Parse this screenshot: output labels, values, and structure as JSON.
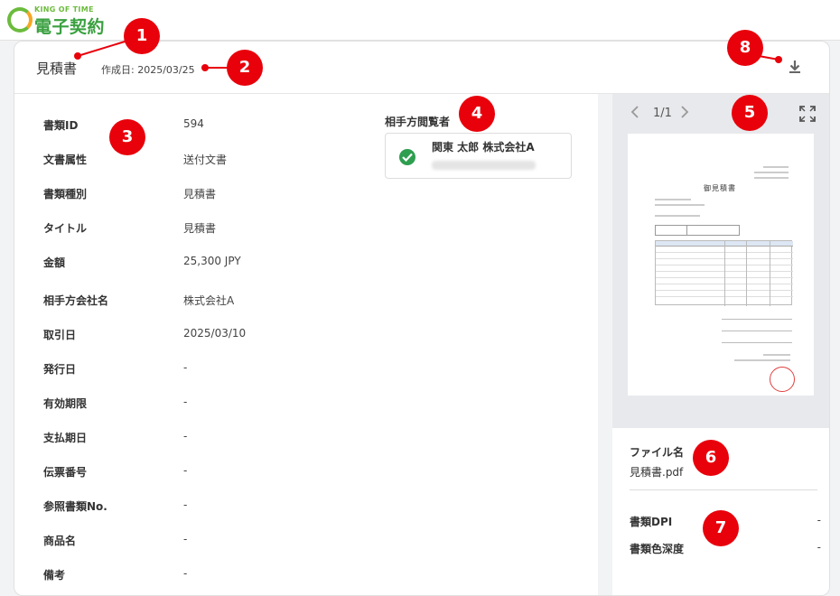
{
  "brand": {
    "top": "KING OF TIME",
    "main": "電子契約"
  },
  "header": {
    "doc_title": "見積書",
    "created": "作成日: 2025/03/25"
  },
  "fields": [
    {
      "label": "書類ID",
      "value": "594"
    },
    {
      "label": "文書属性",
      "value": "送付文書"
    },
    {
      "label": "書類種別",
      "value": "見積書"
    },
    {
      "label": "タイトル",
      "value": "見積書"
    },
    {
      "label": "金額",
      "value": "25,300 JPY"
    },
    {
      "label": "相手方会社名",
      "value": "株式会社A"
    },
    {
      "label": "取引日",
      "value": "2025/03/10"
    },
    {
      "label": "発行日",
      "value": "-"
    },
    {
      "label": "有効期限",
      "value": "-"
    },
    {
      "label": "支払期日",
      "value": "-"
    },
    {
      "label": "伝票番号",
      "value": "-"
    },
    {
      "label": "参照書類No.",
      "value": "-"
    },
    {
      "label": "商品名",
      "value": "-"
    },
    {
      "label": "備考",
      "value": "-"
    }
  ],
  "viewers": {
    "title": "相手方閲覧者",
    "name": "関東 太郎 株式会社A"
  },
  "preview": {
    "page": "1/1",
    "doc_heading": "御見積書"
  },
  "file": {
    "label": "ファイル名",
    "value": "見積書.pdf"
  },
  "meta": [
    {
      "label": "書類DPI",
      "value": "-"
    },
    {
      "label": "書類色深度",
      "value": "-"
    }
  ],
  "markers": [
    "1",
    "2",
    "3",
    "4",
    "5",
    "6",
    "7",
    "8"
  ],
  "colors": {
    "brand_green": "#3aa040",
    "marker_red": "#e8000b",
    "check_green": "#2e9e4f"
  },
  "icons": {
    "download": "download-icon",
    "fullscreen": "fullscreen-icon",
    "prev": "chevron-left-icon",
    "next": "chevron-right-icon",
    "check": "check-circle-icon"
  }
}
